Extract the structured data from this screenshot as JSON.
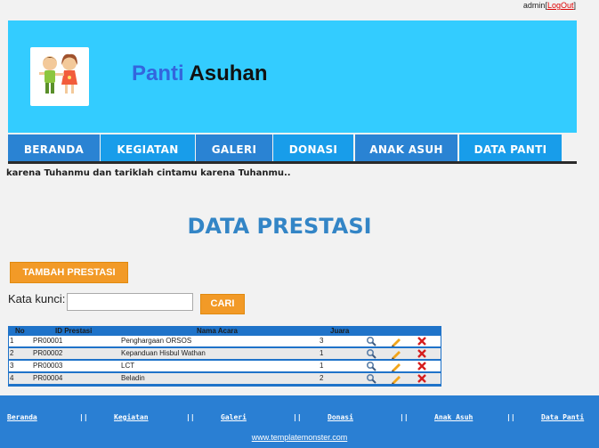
{
  "user": {
    "name": "admin",
    "logout": "LogOut"
  },
  "site": {
    "brand_part1": "Panti",
    "brand_part2": "Asuhan"
  },
  "nav": [
    "BERANDA",
    "KEGIATAN",
    "GALERI",
    "DONASI",
    "ANAK ASUH",
    "DATA PANTI"
  ],
  "marquee": "karena Tuhanmu dan tariklah cintamu karena Tuhanmu..",
  "page": {
    "title": "DATA PRESTASI",
    "add_button": "TAMBAH PRESTASI",
    "search_label": "Kata kunci:",
    "search_value": "",
    "search_button": "CARI"
  },
  "table": {
    "headers": [
      "No",
      "ID Prestasi",
      "Nama Acara",
      "Juara"
    ],
    "rows": [
      [
        "1",
        "PR00001",
        "Penghargaan ORSOS",
        "3"
      ],
      [
        "2",
        "PR00002",
        "Kepanduan Hisbul Wathan",
        "1"
      ],
      [
        "3",
        "PR00003",
        "LCT",
        "1"
      ],
      [
        "4",
        "PR00004",
        "Beladin",
        "2"
      ]
    ]
  },
  "footer": {
    "links": [
      "Beranda",
      "Kegiatan",
      "Galeri",
      "Donasi",
      "Anak Asuh",
      "Data Panti"
    ],
    "separator": "||",
    "credit": "www.templatemonster.com"
  },
  "icons": {
    "view": "magnifier-icon",
    "edit": "pencil-icon",
    "delete": "x-delete-icon"
  },
  "colors": {
    "banner": "#33ccff",
    "nav": "#2a83d3",
    "accent": "#f29a27",
    "footer": "#2a7fd3",
    "title": "#3385c6"
  }
}
